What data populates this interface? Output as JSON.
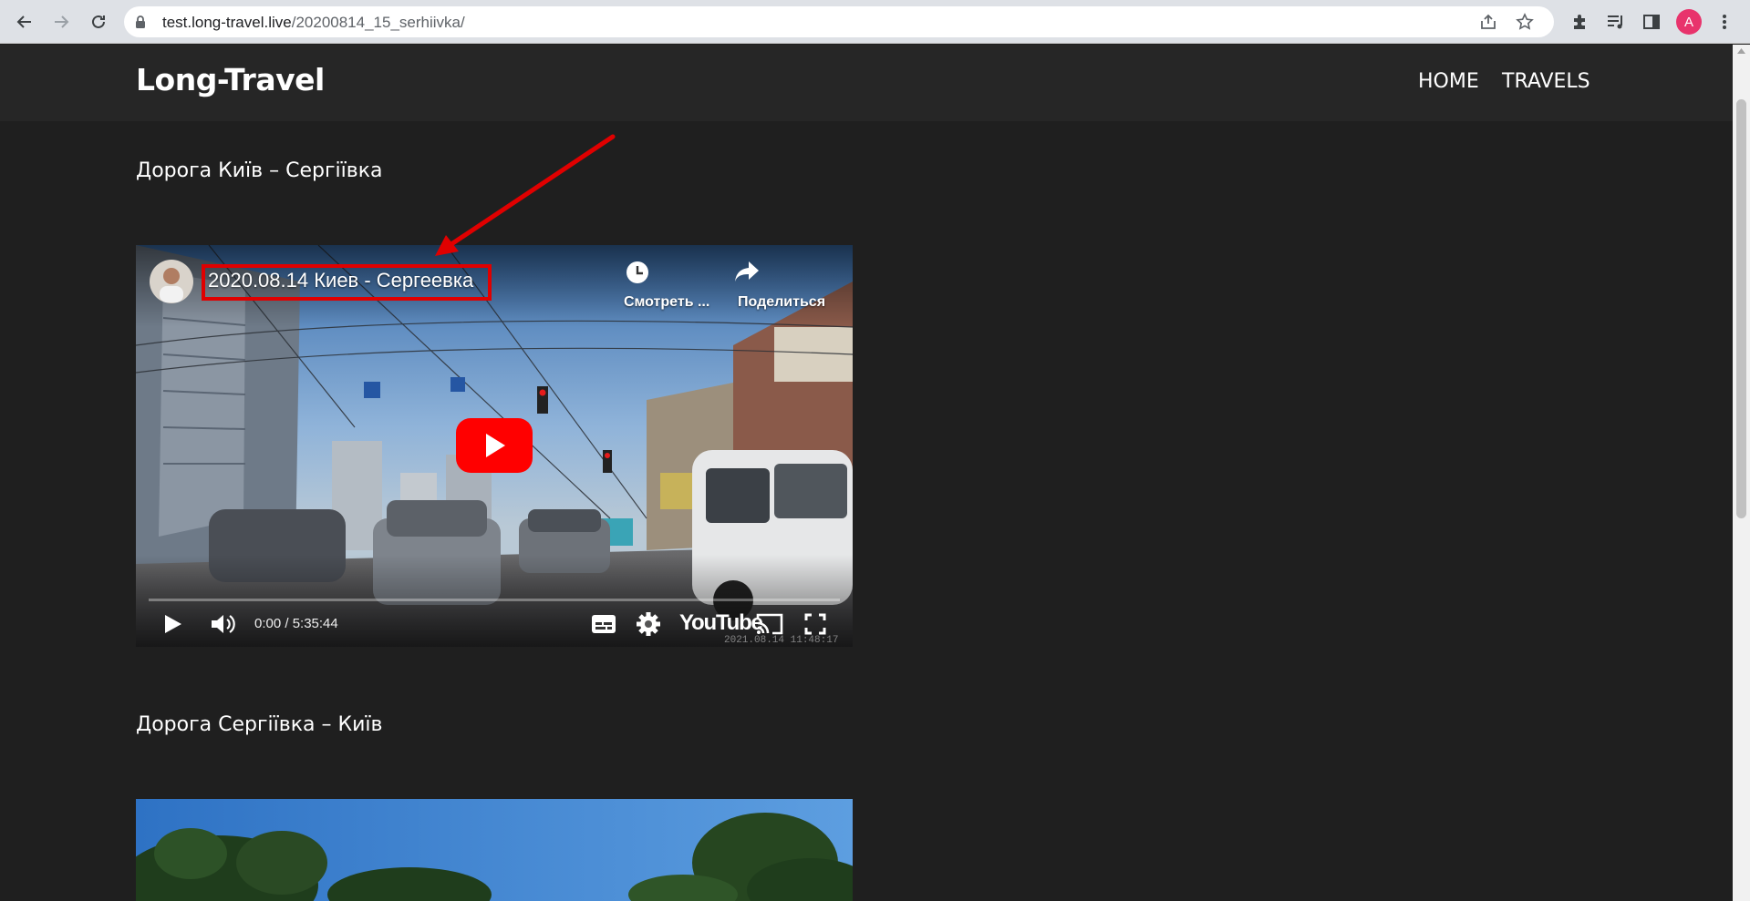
{
  "browser": {
    "url_host": "test.long-travel.live",
    "url_path": "/20200814_15_serhiivka/",
    "profile_initial": "A"
  },
  "site": {
    "title": "Long-Travel",
    "nav": [
      {
        "label": "HOME"
      },
      {
        "label": "TRAVELS"
      }
    ]
  },
  "sections": [
    {
      "title": "Дорога Київ – Сергіївка",
      "video": {
        "title": "2020.08.14 Киев - Сергеевка",
        "watch_later_label": "Смотреть ...",
        "share_label": "Поделиться",
        "time": "0:00 / 5:35:44",
        "brand": "YouTube",
        "stamp": "2021.08.14  11:48:17"
      }
    },
    {
      "title": "Дорога Сергіївка – Київ"
    }
  ],
  "colors": {
    "page_bg": "#1f1f1f",
    "header_bg": "#262626",
    "annotation": "#e00000",
    "youtube_red": "#ff0000",
    "avatar": "#e8336c"
  },
  "icons": [
    "back-icon",
    "forward-icon",
    "reload-icon",
    "lock-icon",
    "share-page-icon",
    "bookmark-star-icon",
    "extensions-icon",
    "media-control-icon",
    "side-panel-icon",
    "menu-dots-icon",
    "clock-icon",
    "share-icon",
    "youtube-play-icon",
    "play-icon",
    "volume-icon",
    "subtitles-icon",
    "settings-gear-icon",
    "cast-icon",
    "fullscreen-icon"
  ]
}
